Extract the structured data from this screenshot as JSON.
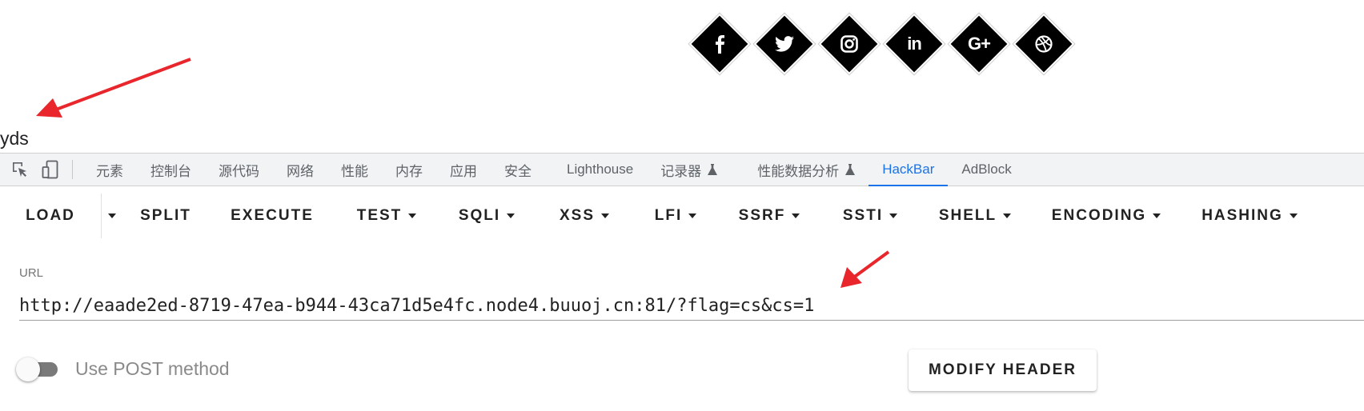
{
  "page": {
    "body_text": "yds",
    "social_icons": [
      {
        "icon": "facebook-icon"
      },
      {
        "icon": "twitter-icon"
      },
      {
        "icon": "instagram-icon"
      },
      {
        "icon": "linkedin-icon",
        "label": "in"
      },
      {
        "icon": "google-plus-icon",
        "label": "G+"
      },
      {
        "icon": "dribbble-icon"
      }
    ]
  },
  "devtools": {
    "tabs": [
      "元素",
      "控制台",
      "源代码",
      "网络",
      "性能",
      "内存",
      "应用",
      "安全",
      "Lighthouse",
      "记录器",
      "性能数据分析",
      "HackBar",
      "AdBlock"
    ],
    "active_tab": "HackBar",
    "accent": "#1a73e8"
  },
  "hackbar": {
    "toolbar": {
      "load": "LOAD",
      "split": "SPLIT",
      "execute": "EXECUTE",
      "test": "TEST",
      "sqli": "SQLI",
      "xss": "XSS",
      "lfi": "LFI",
      "ssrf": "SSRF",
      "ssti": "SSTI",
      "shell": "SHELL",
      "encoding": "ENCODING",
      "hashing": "HASHING"
    },
    "url_label": "URL",
    "url_value": "http://eaade2ed-8719-47ea-b944-43ca71d5e4fc.node4.buuoj.cn:81/?flag=cs&cs=1",
    "post_toggle_label": "Use POST method",
    "post_enabled": false,
    "modify_header_label": "MODIFY HEADER"
  },
  "annotations": {
    "arrow_color": "#e8262b"
  }
}
